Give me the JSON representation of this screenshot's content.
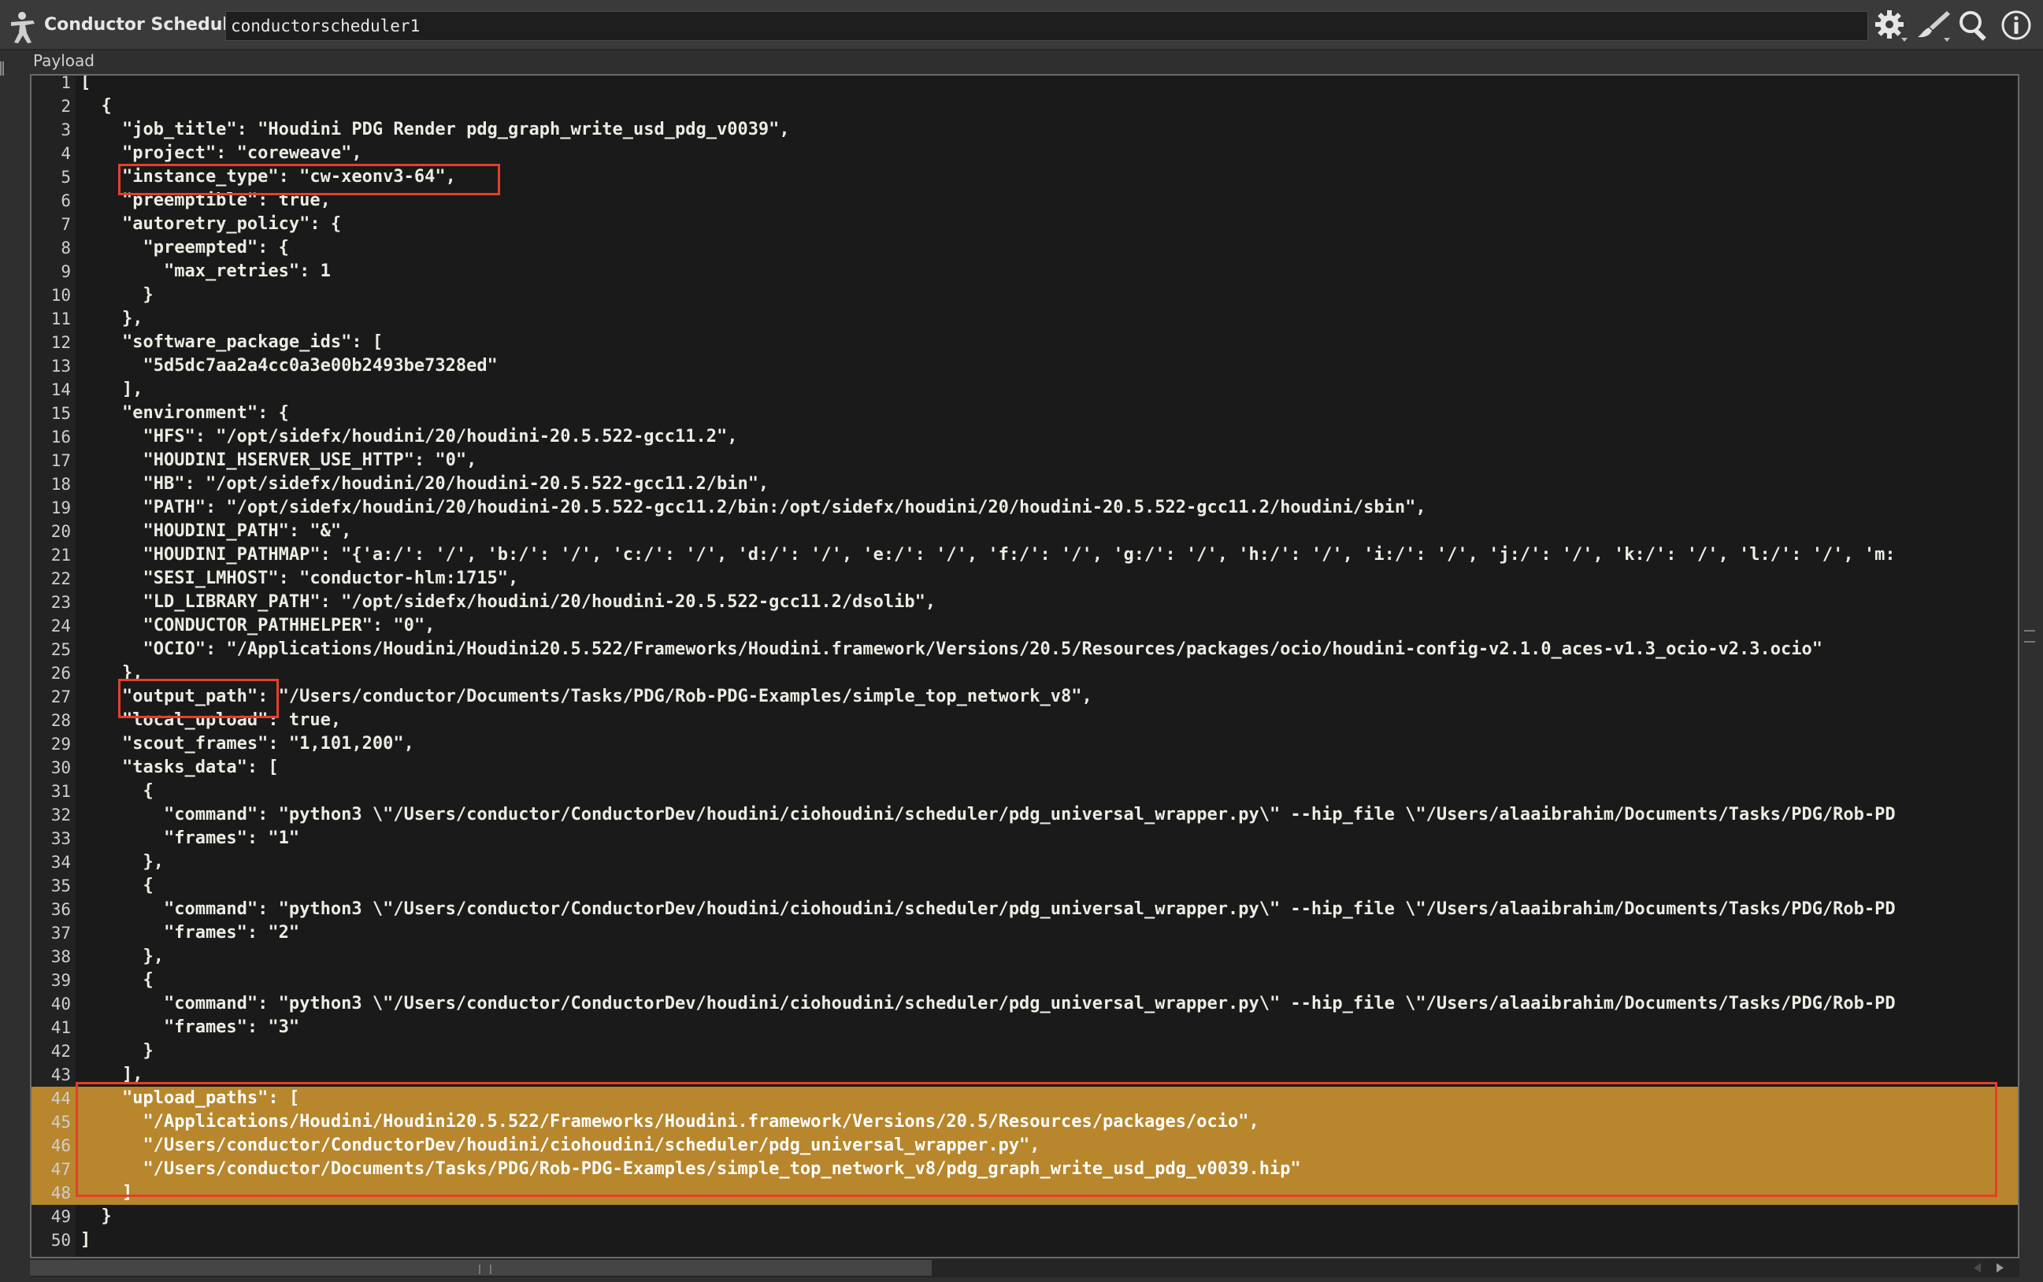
{
  "titlebar": {
    "app_title": "Conductor Scheduler",
    "node_name": "conductorscheduler1",
    "icons": [
      "houdini-figure-icon",
      "gear-icon",
      "brush-icon",
      "search-icon",
      "info-icon"
    ]
  },
  "tab": {
    "label": "Payload"
  },
  "editor": {
    "lines": [
      {
        "n": "1",
        "t": "["
      },
      {
        "n": "2",
        "t": "  {"
      },
      {
        "n": "3",
        "t": "    \"job_title\": \"Houdini PDG Render pdg_graph_write_usd_pdg_v0039\","
      },
      {
        "n": "4",
        "t": "    \"project\": \"coreweave\","
      },
      {
        "n": "5",
        "t": "    \"instance_type\": \"cw-xeonv3-64\","
      },
      {
        "n": "6",
        "t": "    \"preemptible\": true,"
      },
      {
        "n": "7",
        "t": "    \"autoretry_policy\": {"
      },
      {
        "n": "8",
        "t": "      \"preempted\": {"
      },
      {
        "n": "9",
        "t": "        \"max_retries\": 1"
      },
      {
        "n": "10",
        "t": "      }"
      },
      {
        "n": "11",
        "t": "    },"
      },
      {
        "n": "12",
        "t": "    \"software_package_ids\": ["
      },
      {
        "n": "13",
        "t": "      \"5d5dc7aa2a4cc0a3e00b2493be7328ed\""
      },
      {
        "n": "14",
        "t": "    ],"
      },
      {
        "n": "15",
        "t": "    \"environment\": {"
      },
      {
        "n": "16",
        "t": "      \"HFS\": \"/opt/sidefx/houdini/20/houdini-20.5.522-gcc11.2\","
      },
      {
        "n": "17",
        "t": "      \"HOUDINI_HSERVER_USE_HTTP\": \"0\","
      },
      {
        "n": "18",
        "t": "      \"HB\": \"/opt/sidefx/houdini/20/houdini-20.5.522-gcc11.2/bin\","
      },
      {
        "n": "19",
        "t": "      \"PATH\": \"/opt/sidefx/houdini/20/houdini-20.5.522-gcc11.2/bin:/opt/sidefx/houdini/20/houdini-20.5.522-gcc11.2/houdini/sbin\","
      },
      {
        "n": "20",
        "t": "      \"HOUDINI_PATH\": \"&\","
      },
      {
        "n": "21",
        "t": "      \"HOUDINI_PATHMAP\": \"{'a:/': '/', 'b:/': '/', 'c:/': '/', 'd:/': '/', 'e:/': '/', 'f:/': '/', 'g:/': '/', 'h:/': '/', 'i:/': '/', 'j:/': '/', 'k:/': '/', 'l:/': '/', 'm:"
      },
      {
        "n": "22",
        "t": "      \"SESI_LMHOST\": \"conductor-hlm:1715\","
      },
      {
        "n": "23",
        "t": "      \"LD_LIBRARY_PATH\": \"/opt/sidefx/houdini/20/houdini-20.5.522-gcc11.2/dsolib\","
      },
      {
        "n": "24",
        "t": "      \"CONDUCTOR_PATHHELPER\": \"0\","
      },
      {
        "n": "25",
        "t": "      \"OCIO\": \"/Applications/Houdini/Houdini20.5.522/Frameworks/Houdini.framework/Versions/20.5/Resources/packages/ocio/houdini-config-v2.1.0_aces-v1.3_ocio-v2.3.ocio\""
      },
      {
        "n": "26",
        "t": "    },"
      },
      {
        "n": "27",
        "t": "    \"output_path\": \"/Users/conductor/Documents/Tasks/PDG/Rob-PDG-Examples/simple_top_network_v8\","
      },
      {
        "n": "28",
        "t": "    \"local_upload\": true,"
      },
      {
        "n": "29",
        "t": "    \"scout_frames\": \"1,101,200\","
      },
      {
        "n": "30",
        "t": "    \"tasks_data\": ["
      },
      {
        "n": "31",
        "t": "      {"
      },
      {
        "n": "32",
        "t": "        \"command\": \"python3 \\\"/Users/conductor/ConductorDev/houdini/ciohoudini/scheduler/pdg_universal_wrapper.py\\\" --hip_file \\\"/Users/alaaibrahim/Documents/Tasks/PDG/Rob-PD"
      },
      {
        "n": "33",
        "t": "        \"frames\": \"1\""
      },
      {
        "n": "34",
        "t": "      },"
      },
      {
        "n": "35",
        "t": "      {"
      },
      {
        "n": "36",
        "t": "        \"command\": \"python3 \\\"/Users/conductor/ConductorDev/houdini/ciohoudini/scheduler/pdg_universal_wrapper.py\\\" --hip_file \\\"/Users/alaaibrahim/Documents/Tasks/PDG/Rob-PD"
      },
      {
        "n": "37",
        "t": "        \"frames\": \"2\""
      },
      {
        "n": "38",
        "t": "      },"
      },
      {
        "n": "39",
        "t": "      {"
      },
      {
        "n": "40",
        "t": "        \"command\": \"python3 \\\"/Users/conductor/ConductorDev/houdini/ciohoudini/scheduler/pdg_universal_wrapper.py\\\" --hip_file \\\"/Users/alaaibrahim/Documents/Tasks/PDG/Rob-PD"
      },
      {
        "n": "41",
        "t": "        \"frames\": \"3\""
      },
      {
        "n": "42",
        "t": "      }"
      },
      {
        "n": "43",
        "t": "    ],"
      },
      {
        "n": "44",
        "t": "    \"upload_paths\": ["
      },
      {
        "n": "45",
        "t": "      \"/Applications/Houdini/Houdini20.5.522/Frameworks/Houdini.framework/Versions/20.5/Resources/packages/ocio\","
      },
      {
        "n": "46",
        "t": "      \"/Users/conductor/ConductorDev/houdini/ciohoudini/scheduler/pdg_universal_wrapper.py\","
      },
      {
        "n": "47",
        "t": "      \"/Users/conductor/Documents/Tasks/PDG/Rob-PDG-Examples/simple_top_network_v8/pdg_graph_write_usd_pdg_v0039.hip\""
      },
      {
        "n": "48",
        "t": "    ]"
      },
      {
        "n": "49",
        "t": "  }"
      },
      {
        "n": "50",
        "t": "]"
      }
    ],
    "highlighted_lines": [
      "44",
      "45",
      "46",
      "47",
      "48"
    ]
  },
  "colors": {
    "selection": "#b8862c",
    "annotation_box": "#e3402a",
    "editor_bg": "#1a1a1a",
    "panel_bg": "#2f2f2f"
  }
}
